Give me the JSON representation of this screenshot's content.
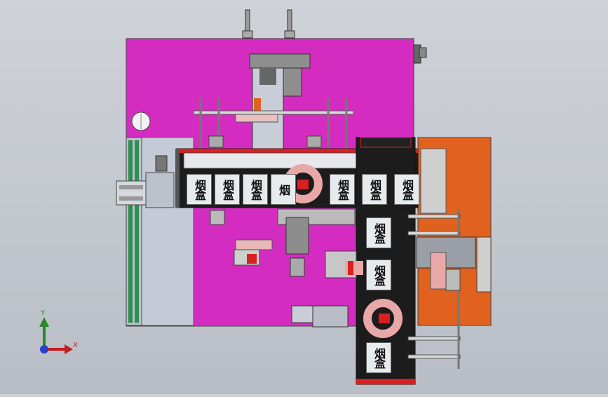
{
  "scene": {
    "colors": {
      "background": "#c5c9cf",
      "main_plate": "#d42cc0",
      "side_plate": "#e0621e",
      "conveyor": "#1c1c1c",
      "box_face": "#e8ebee",
      "metal_light": "#c9cdd8",
      "metal_dark": "#6e6e6e",
      "red_accent": "#d92020"
    },
    "horizontal_conveyor_boxes": [
      "烟盒",
      "烟盒",
      "烟盒",
      "烟",
      "",
      "烟盒",
      "烟盒",
      "烟盒"
    ],
    "vertical_conveyor_boxes": [
      "烟盒",
      "烟盒",
      "",
      "烟盒"
    ]
  },
  "axis_triad": {
    "y_label": "Y",
    "x_label": "X"
  }
}
